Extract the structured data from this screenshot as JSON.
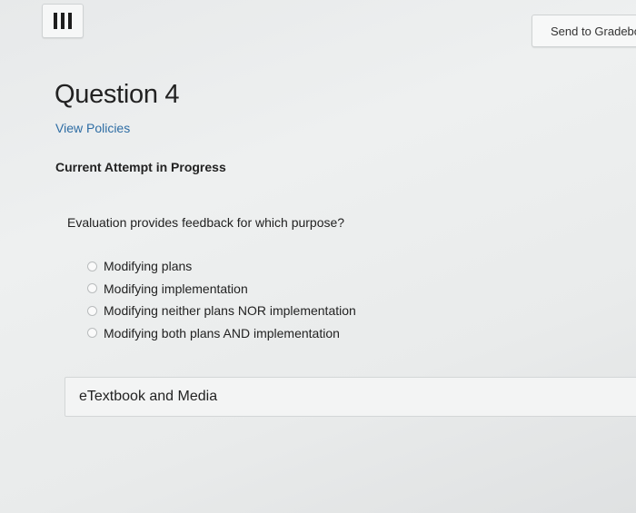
{
  "header": {
    "menu_icon": "hamburger-menu-icon",
    "gradebook_label": "Send to Gradebo"
  },
  "question": {
    "title": "Question 4",
    "policies_link": "View Policies",
    "attempt_status": "Current Attempt in Progress",
    "prompt": "Evaluation provides feedback for which purpose?",
    "options": [
      {
        "label": "Modifying plans"
      },
      {
        "label": "Modifying implementation"
      },
      {
        "label": "Modifying neither plans NOR implementation"
      },
      {
        "label": "Modifying both plans AND implementation"
      }
    ]
  },
  "resources": {
    "etextbook_label": "eTextbook and Media"
  },
  "colors": {
    "link": "#2e6da4",
    "text": "#222222",
    "panel": "#f3f4f4"
  }
}
